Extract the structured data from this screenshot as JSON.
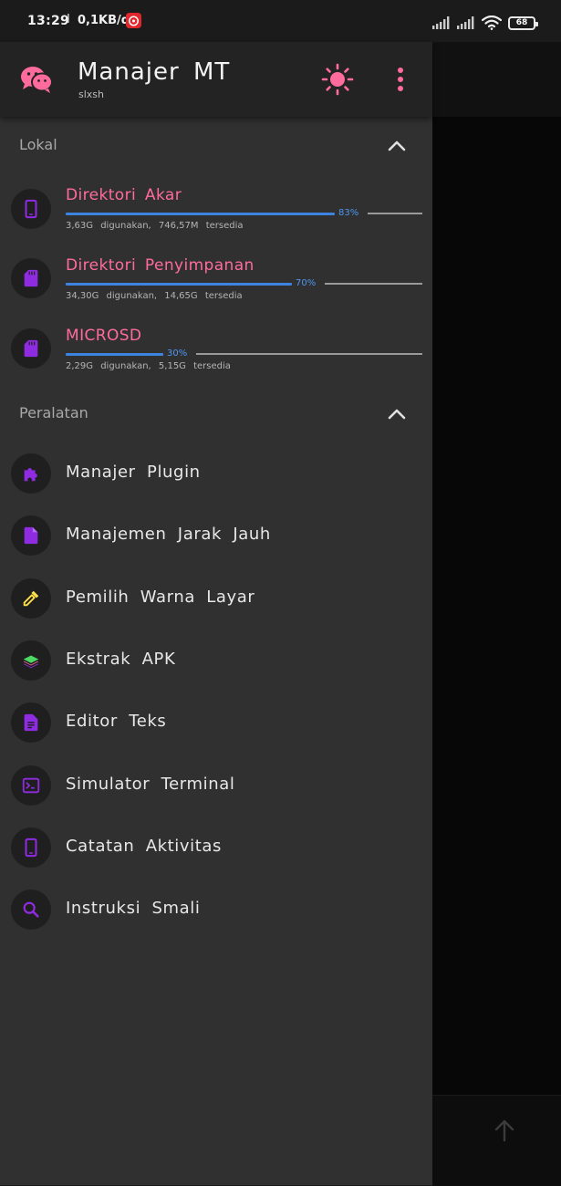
{
  "status_bar": {
    "time": "13:29",
    "separator": "I",
    "net_speed": "0,1KB/d",
    "battery": "68",
    "icons": [
      "netease-music-icon",
      "signal-icon",
      "signal-icon",
      "wifi-icon",
      "battery-icon"
    ]
  },
  "header": {
    "title": "Manajer MT",
    "subtitle": "slxsh",
    "icons": [
      "app-logo-icon",
      "theme-brightness-icon",
      "more-vert-icon"
    ]
  },
  "colors": {
    "accent_pink": "#ff6b9d",
    "progress_blue": "#3d83e0",
    "icon_purple": "#8f2be0",
    "drawer_bg": "#303030"
  },
  "lokal": {
    "title": "Lokal",
    "items": [
      {
        "name": "Direktori Akar",
        "percent_label": "83%",
        "used_fraction": 0.83,
        "info": "3,63G digunakan, 746,57M tersedia",
        "icon": "phone-icon"
      },
      {
        "name": "Direktori Penyimpanan",
        "percent_label": "70%",
        "used_fraction": 0.7,
        "info": "34,30G digunakan, 14,65G tersedia",
        "icon": "sd-card-icon"
      },
      {
        "name": "MICROSD",
        "percent_label": "30%",
        "used_fraction": 0.3,
        "info": "2,29G digunakan, 5,15G tersedia",
        "icon": "sd-card-icon"
      }
    ]
  },
  "peralatan": {
    "title": "Peralatan",
    "items": [
      {
        "label": "Manajer Plugin",
        "icon": "puzzle-icon"
      },
      {
        "label": "Manajemen Jarak Jauh",
        "icon": "file-icon"
      },
      {
        "label": "Pemilih Warna Layar",
        "icon": "eyedropper-icon"
      },
      {
        "label": "Ekstrak APK",
        "icon": "layers-icon"
      },
      {
        "label": "Editor Teks",
        "icon": "document-icon"
      },
      {
        "label": "Simulator Terminal",
        "icon": "terminal-icon"
      },
      {
        "label": "Catatan Aktivitas",
        "icon": "phone-icon"
      },
      {
        "label": "Instruksi Smali",
        "icon": "search-icon"
      }
    ]
  },
  "background_fab": {
    "icon": "arrow-up-icon"
  }
}
